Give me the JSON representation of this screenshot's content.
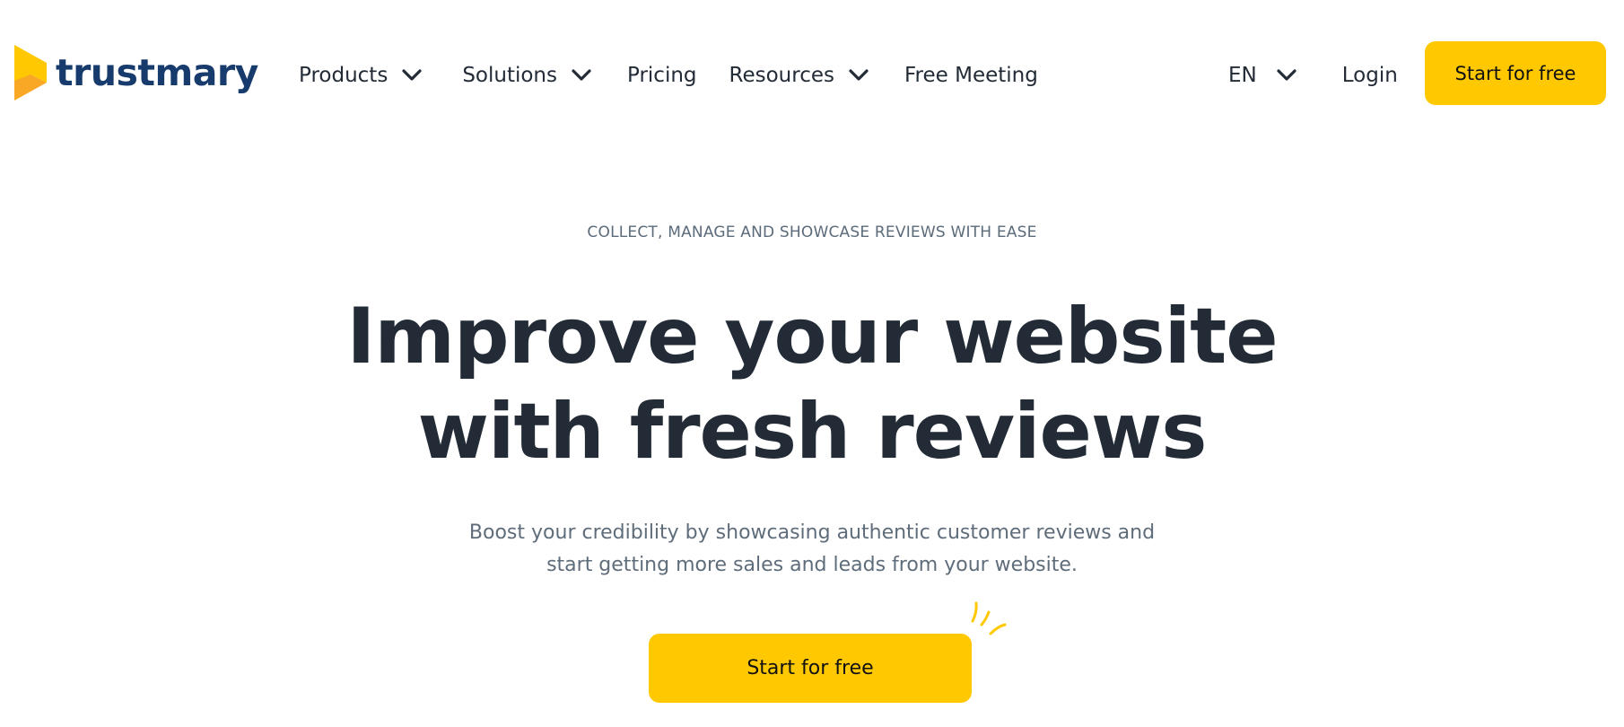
{
  "brand": {
    "name": "trustmary",
    "logo_icon": "play-chevron-logo-icon",
    "colors": {
      "accent": "#ffc800",
      "accent_dark": "#f9a825",
      "wordmark": "#173b6c",
      "text": "#222b36",
      "muted": "#5f6d7b"
    }
  },
  "nav": {
    "items": [
      {
        "label": "Products",
        "has_dropdown": true
      },
      {
        "label": "Solutions",
        "has_dropdown": true
      },
      {
        "label": "Pricing",
        "has_dropdown": false
      },
      {
        "label": "Resources",
        "has_dropdown": true
      },
      {
        "label": "Free Meeting",
        "has_dropdown": false
      }
    ],
    "language": {
      "selected": "EN",
      "icon": "chevron-down-icon"
    },
    "login_label": "Login",
    "cta_label": "Start for free"
  },
  "hero": {
    "eyebrow": "COLLECT, MANAGE AND SHOWCASE REVIEWS WITH EASE",
    "headline_line1": "Improve your website",
    "headline_line2": "with fresh reviews",
    "subtitle_line1": "Boost your credibility by showcasing authentic customer reviews and",
    "subtitle_line2": "start getting more sales and leads from your website.",
    "cta_label": "Start for free",
    "decoration_icon": "sparkle-lines-icon"
  }
}
